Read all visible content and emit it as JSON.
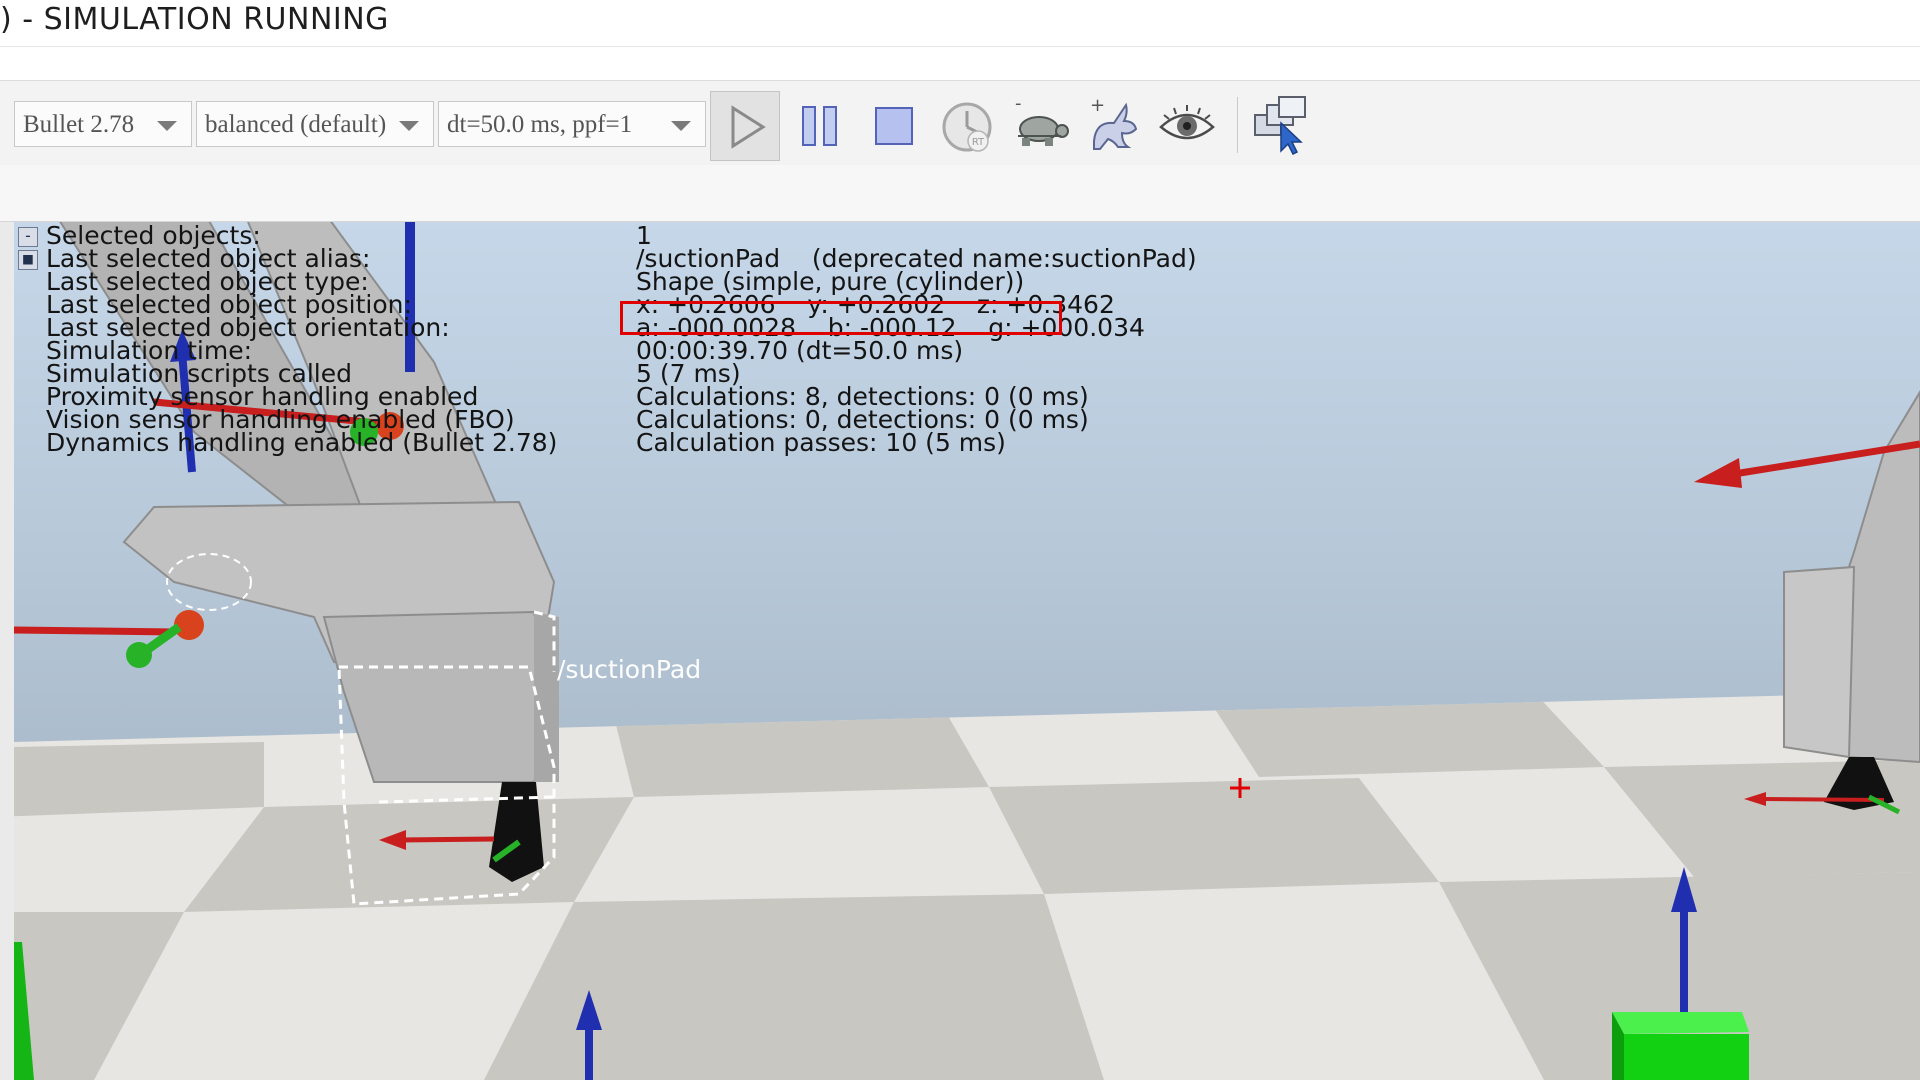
{
  "window": {
    "title": ") - SIMULATION RUNNING"
  },
  "toolbar": {
    "engine_select": "Bullet 2.78",
    "accuracy_select": "balanced (default)",
    "timestep_select": "dt=50.0 ms, ppf=1",
    "buttons": [
      {
        "name": "start-simulation-button",
        "icon": "play-icon"
      },
      {
        "name": "pause-simulation-button",
        "icon": "pause-icon"
      },
      {
        "name": "stop-simulation-button",
        "icon": "stop-icon"
      },
      {
        "name": "real-time-button",
        "icon": "clock-rt-icon"
      },
      {
        "name": "slow-down-button",
        "icon": "turtle-icon"
      },
      {
        "name": "speed-up-button",
        "icon": "rabbit-icon"
      },
      {
        "name": "visualization-toggle-button",
        "icon": "eye-icon"
      },
      {
        "name": "thread-rendering-button",
        "icon": "windows-cursor-icon"
      }
    ],
    "turtle_sign": "-",
    "rabbit_sign": "+",
    "clock_badge": "RT"
  },
  "info": {
    "rows": [
      {
        "label": "Selected objects:",
        "value": "1",
        "box": "-"
      },
      {
        "label": "Last selected object alias:",
        "value": "/suctionPad    (deprecated name:suctionPad)",
        "box": "■"
      },
      {
        "label": "Last selected object type:",
        "value": "Shape (simple, pure (cylinder))"
      },
      {
        "label": "Last selected object position:",
        "value": "x: +0.2606    y: +0.2602    z: +0.3462"
      },
      {
        "label": "Last selected object orientation:",
        "value": "a: -000.0028    b: -000.12    g: +000.034"
      },
      {
        "label": "Simulation time:",
        "value": "00:00:39.70 (dt=50.0 ms)"
      },
      {
        "label": "Simulation scripts called",
        "value": "5 (7 ms)"
      },
      {
        "label": "Proximity sensor handling enabled",
        "value": "Calculations: 8, detections: 0 (0 ms)"
      },
      {
        "label": "Vision sensor handling enabled (FBO)",
        "value": "Calculations: 0, detections: 0 (0 ms)"
      },
      {
        "label": "Dynamics handling enabled (Bullet 2.78)",
        "value": "Calculation passes: 10 (5 ms)"
      }
    ]
  },
  "scene": {
    "selected_object_label": "/suctionPad",
    "colors": {
      "floor_light": "#e8e6e2",
      "floor_dark": "#c9c7c2",
      "robot_gray": "#b9b9b9",
      "axis_x": "#c81e1e",
      "axis_y": "#22b322",
      "axis_z": "#1f2fb0",
      "highlight": "#e00000",
      "cube_green": "#12d012"
    }
  }
}
